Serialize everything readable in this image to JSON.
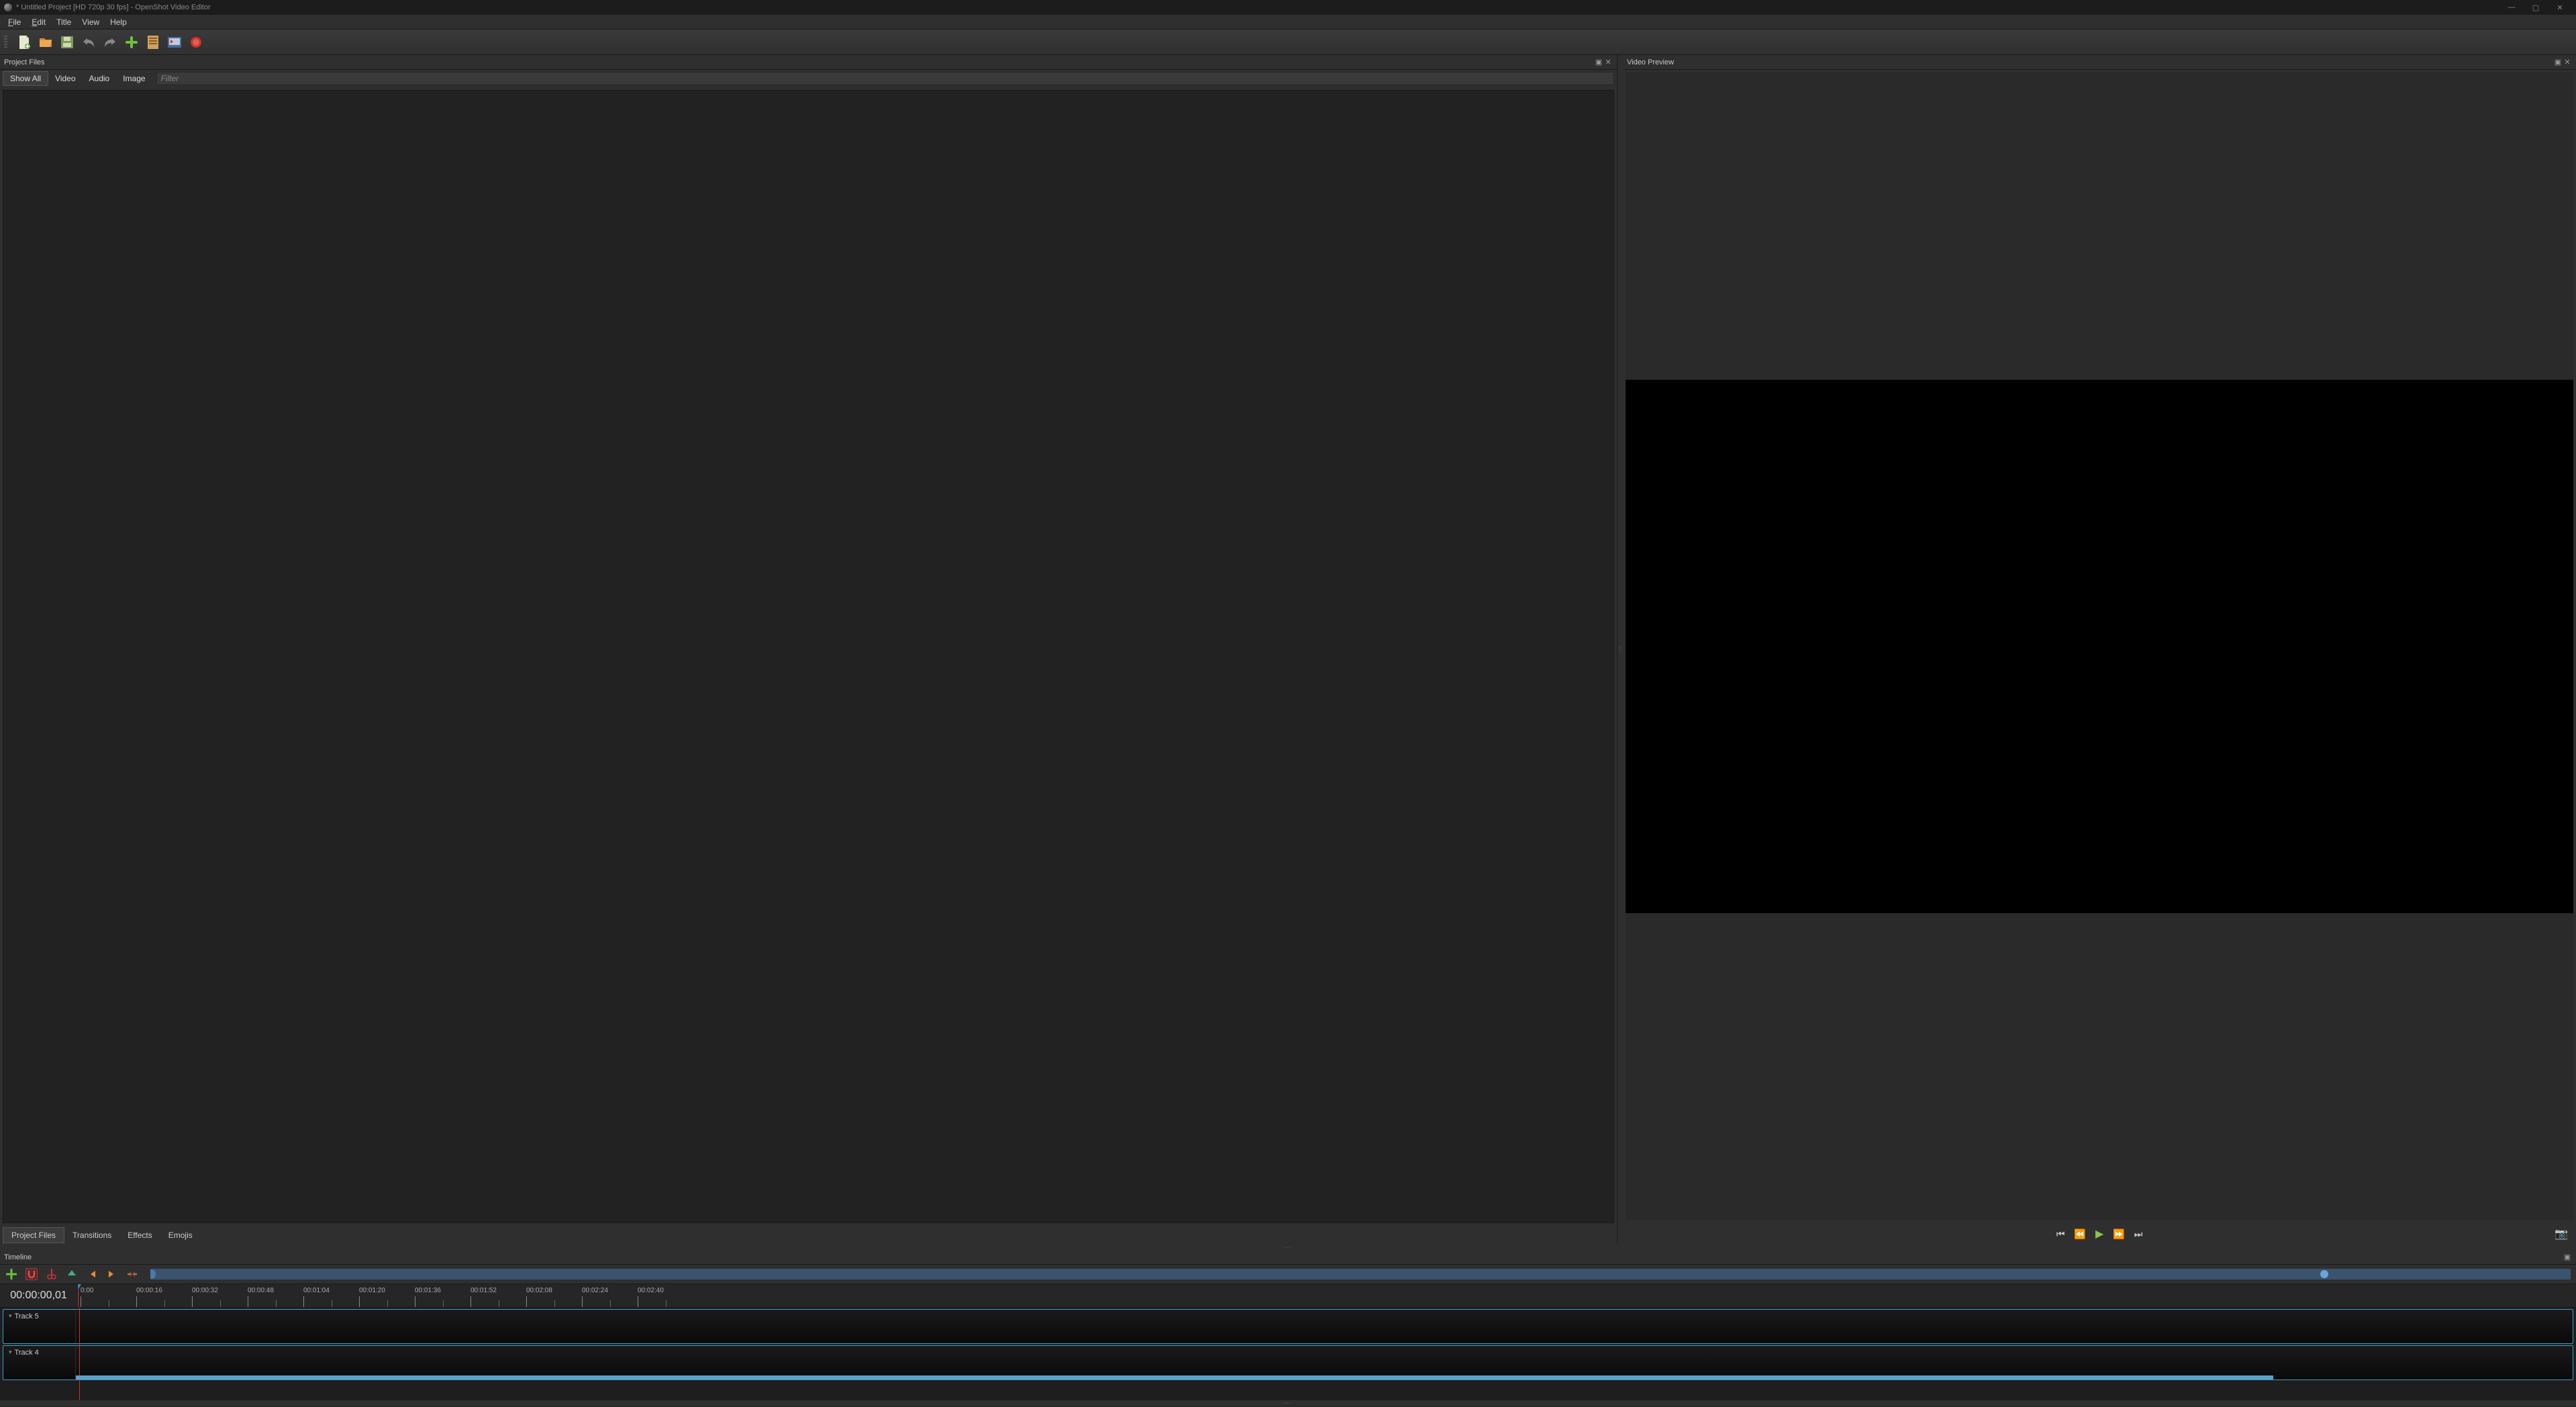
{
  "title": "* Untitled Project [HD 720p 30 fps] - OpenShot Video Editor",
  "menu": {
    "file": "File",
    "edit": "Edit",
    "title": "Title",
    "view": "View",
    "help": "Help"
  },
  "panels": {
    "project_files": "Project Files",
    "video_preview": "Video Preview",
    "timeline": "Timeline"
  },
  "filter_tabs": {
    "show_all": "Show All",
    "video": "Video",
    "audio": "Audio",
    "image": "Image"
  },
  "filter_placeholder": "Filter",
  "bottom_tabs": {
    "project_files": "Project Files",
    "transitions": "Transitions",
    "effects": "Effects",
    "emojis": "Emojis"
  },
  "timecode": "00:00:00,01",
  "ruler_marks": [
    "0:00",
    "00:00:16",
    "00:00:32",
    "00:00:48",
    "00:01:04",
    "00:01:20",
    "00:01:36",
    "00:01:52",
    "00:02:08",
    "00:02:24",
    "00:02:40"
  ],
  "tracks": [
    {
      "name": "Track 5"
    },
    {
      "name": "Track 4"
    }
  ],
  "colors": {
    "accent": "#3aa0c8",
    "play": "#8bc34a",
    "red": "#c33"
  }
}
